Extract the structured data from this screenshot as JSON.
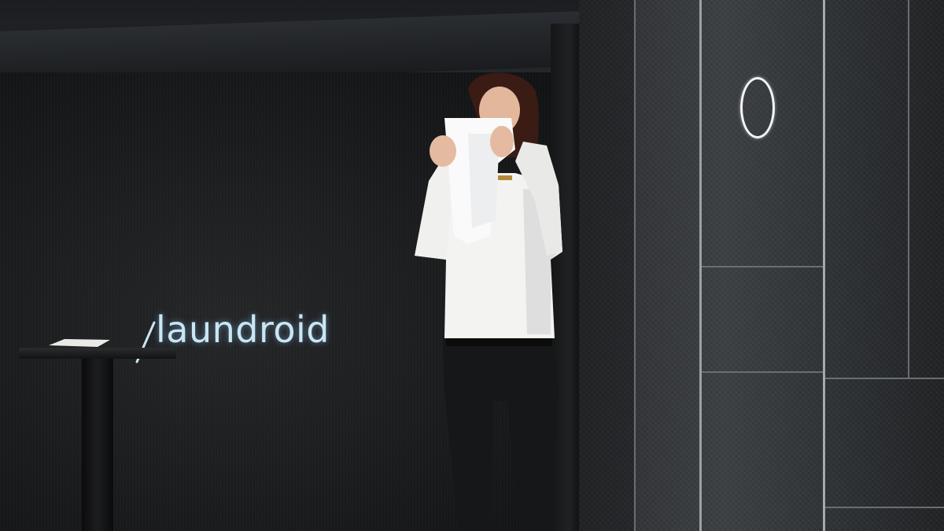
{
  "scene": {
    "brand_text": "laundroid",
    "accent_color": "#c9e6f5",
    "cabinet_logo": "circle-logo"
  }
}
